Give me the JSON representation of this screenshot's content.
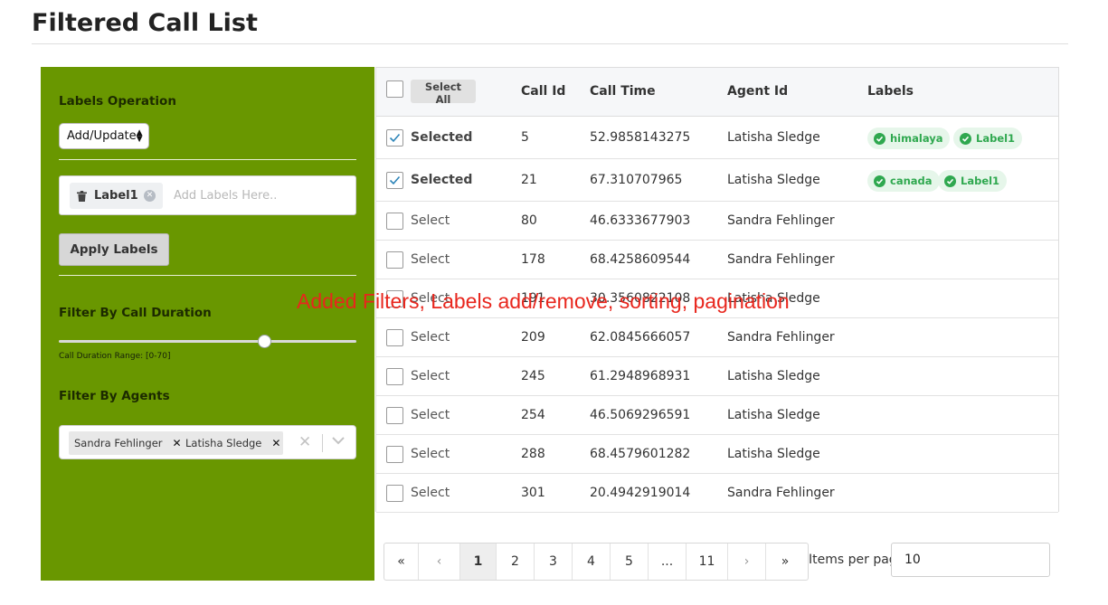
{
  "page": {
    "title": "Filtered Call List"
  },
  "sidebar": {
    "labels_operation": {
      "heading": "Labels Operation",
      "selected": "Add/Update"
    },
    "labels_input": {
      "chip": "Label1",
      "placeholder": "Add Labels Here.."
    },
    "apply_button": "Apply Labels",
    "duration": {
      "heading": "Filter By Call Duration",
      "range_text": "Call Duration Range: [0-70]",
      "slider_fraction": 0.69
    },
    "agents": {
      "heading": "Filter By Agents",
      "chips": [
        "Sandra Fehlinger",
        "Latisha Sledge"
      ]
    }
  },
  "table": {
    "select_all": "Select All",
    "headers": {
      "call_id": "Call Id",
      "call_time": "Call Time",
      "agent_id": "Agent Id",
      "labels": "Labels"
    },
    "rows": [
      {
        "checked": true,
        "select_text": "Selected",
        "call_id": "5",
        "call_time": "52.9858143275",
        "agent": "Latisha Sledge",
        "labels": [
          "himalaya",
          "Label1"
        ]
      },
      {
        "checked": true,
        "select_text": "Selected",
        "call_id": "21",
        "call_time": "67.310707965",
        "agent": "Latisha Sledge",
        "labels": [
          "canada",
          "Label1"
        ]
      },
      {
        "checked": false,
        "select_text": "Select",
        "call_id": "80",
        "call_time": "46.6333677903",
        "agent": "Sandra Fehlinger",
        "labels": []
      },
      {
        "checked": false,
        "select_text": "Select",
        "call_id": "178",
        "call_time": "68.4258609544",
        "agent": "Sandra Fehlinger",
        "labels": []
      },
      {
        "checked": false,
        "select_text": "Select",
        "call_id": "191",
        "call_time": "30.3560822108",
        "agent": "Latisha Sledge",
        "labels": []
      },
      {
        "checked": false,
        "select_text": "Select",
        "call_id": "209",
        "call_time": "62.0845666057",
        "agent": "Sandra Fehlinger",
        "labels": []
      },
      {
        "checked": false,
        "select_text": "Select",
        "call_id": "245",
        "call_time": "61.2948968931",
        "agent": "Latisha Sledge",
        "labels": []
      },
      {
        "checked": false,
        "select_text": "Select",
        "call_id": "254",
        "call_time": "46.5069296591",
        "agent": "Latisha Sledge",
        "labels": []
      },
      {
        "checked": false,
        "select_text": "Select",
        "call_id": "288",
        "call_time": "68.4579601282",
        "agent": "Latisha Sledge",
        "labels": []
      },
      {
        "checked": false,
        "select_text": "Select",
        "call_id": "301",
        "call_time": "20.4942919014",
        "agent": "Sandra Fehlinger",
        "labels": []
      }
    ]
  },
  "overlay_caption": "Added Filters, Labels add/remove, sorting, pagination",
  "pagination": {
    "pages": [
      "«",
      "‹",
      "1",
      "2",
      "3",
      "4",
      "5",
      "...",
      "11",
      "›",
      "»"
    ],
    "active": "1",
    "items_per_page_label": "Items per page",
    "items_per_page_value": "10"
  },
  "colors": {
    "sidebar_bg": "#699700",
    "label_badge_bg": "#e6f6ea",
    "label_badge_text": "#2fa84f",
    "overlay_text": "#e8261d"
  },
  "icons": [
    "trash-icon",
    "clear-circle-icon",
    "check-icon",
    "chip-remove-icon",
    "clear-x-icon",
    "chevron-down-icon",
    "check-circle-icon"
  ]
}
